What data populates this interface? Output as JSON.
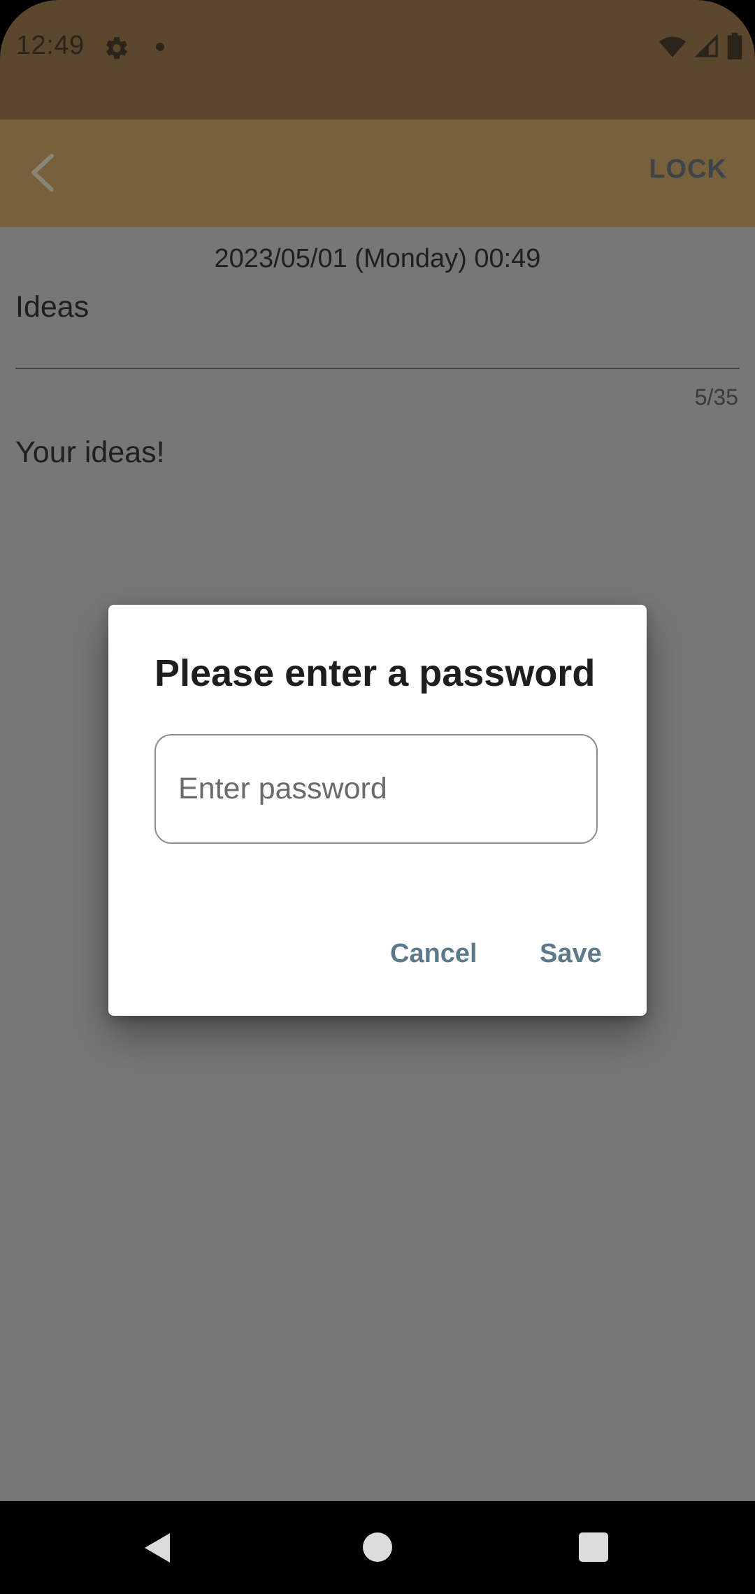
{
  "status_bar": {
    "time": "12:49",
    "icons": [
      "gear-icon",
      "notification-dot-icon",
      "wifi-icon",
      "cell-signal-icon",
      "battery-icon"
    ],
    "background_color": "#5a472e"
  },
  "app_bar": {
    "back_icon": "chevron-left-icon",
    "lock_label": "LOCK",
    "background_color": "#77603c"
  },
  "note": {
    "date": "2023/05/01 (Monday) 00:49",
    "title": "Ideas",
    "counter": "5/35",
    "body": "Your ideas!"
  },
  "dialog": {
    "title": "Please enter a password",
    "password_placeholder": "Enter password",
    "cancel_label": "Cancel",
    "save_label": "Save",
    "button_color": "#5d7a8a"
  },
  "nav_bar": {
    "icons": [
      "back-triangle-icon",
      "home-circle-icon",
      "recents-square-icon"
    ]
  }
}
